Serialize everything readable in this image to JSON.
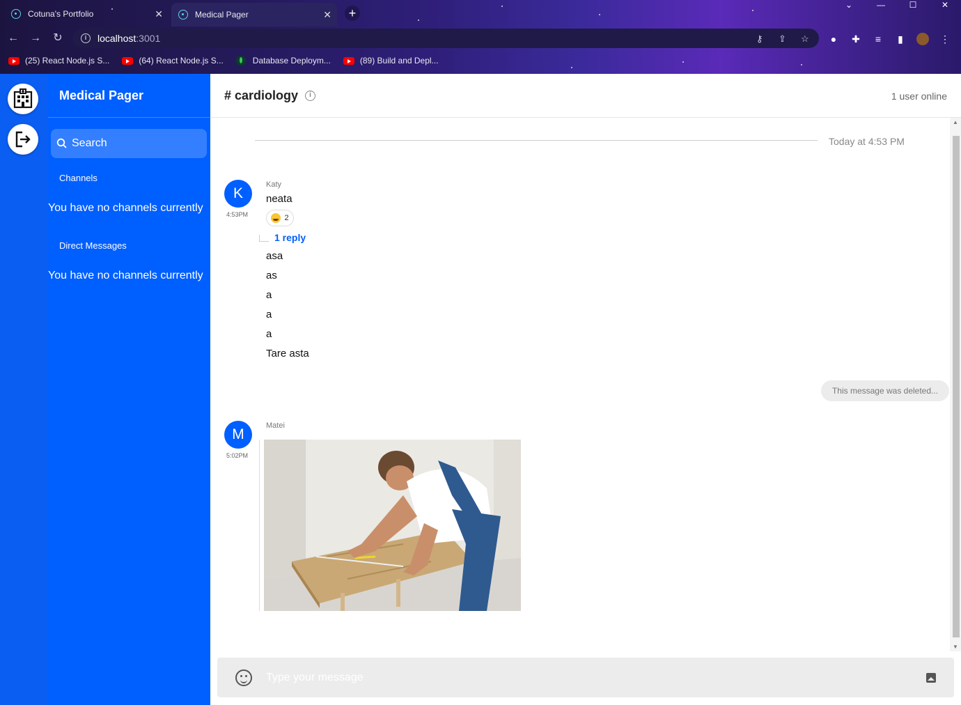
{
  "browser": {
    "tabs": [
      {
        "title": "Cotuna's Portfolio",
        "active": false
      },
      {
        "title": "Medical Pager",
        "active": true
      }
    ],
    "new_tab": "+",
    "url_host": "localhost",
    "url_port": ":3001",
    "bookmarks": [
      {
        "label": "(25) React Node.js S...",
        "icon": "youtube-icon"
      },
      {
        "label": "(64) React Node.js S...",
        "icon": "youtube-icon"
      },
      {
        "label": "Database Deploym...",
        "icon": "mongodb-icon"
      },
      {
        "label": "(89) Build and Depl...",
        "icon": "youtube-icon"
      }
    ]
  },
  "sidebar": {
    "title": "Medical Pager",
    "search_label": "Search",
    "channels_label": "Channels",
    "channels_empty": "You have no channels currently",
    "dm_label": "Direct Messages",
    "dm_empty": "You have no channels currently"
  },
  "header": {
    "channel": "# cardiology",
    "online": "1 user online"
  },
  "messages": {
    "date_separator": "Today at 4:53 PM",
    "group1": {
      "avatar_letter": "K",
      "time": "4:53PM",
      "author": "Katy",
      "first": "neata",
      "reaction_count": "2",
      "reply": "1 reply",
      "lines": [
        "asa",
        "as",
        "a",
        "a",
        "a",
        "Tare asta"
      ]
    },
    "deleted": "This message was deleted...",
    "group2": {
      "avatar_letter": "M",
      "time": "5:02PM",
      "author": "Matei"
    }
  },
  "composer": {
    "placeholder": "Type your message"
  },
  "colors": {
    "primary": "#005fff",
    "iconbar": "#0a5ef2",
    "composer_bg": "#ececec"
  }
}
